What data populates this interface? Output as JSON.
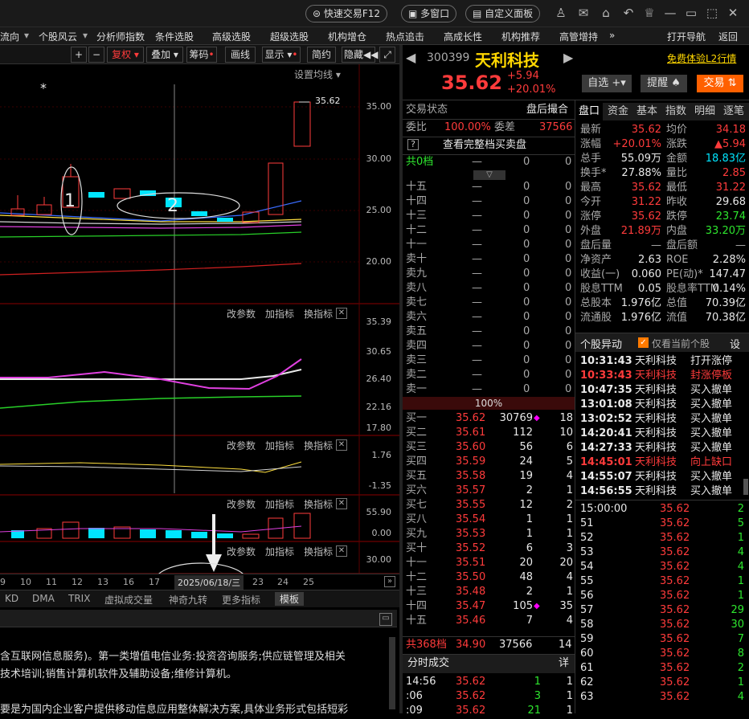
{
  "topbar": {
    "quick_trade": "快速交易F12",
    "multi_window": "多窗口",
    "custom_panel": "自定义面板"
  },
  "nav": {
    "items": [
      "流向",
      "个股风云",
      "分析师指数",
      "条件选股",
      "高级选股",
      "超级选股",
      "机构增仓",
      "热点追击",
      "高成长性",
      "机构推荐",
      "高管增持"
    ],
    "more": "»",
    "open_nav": "打开导航",
    "back": "返回"
  },
  "chart_toolbar": {
    "plus": "+",
    "minus": "−",
    "fq": "复权",
    "overlay": "叠加",
    "chips": "筹码",
    "draw": "画线",
    "display": "显示",
    "simple": "简约",
    "hide": "隐藏"
  },
  "main_chart": {
    "settings": "设置均线",
    "annot_price": "35.62",
    "axis": [
      "35.00",
      "30.00",
      "25.00",
      "20.00"
    ],
    "star": "*",
    "label1": "1",
    "label2": "2"
  },
  "panels": [
    {
      "tools": [
        "改参数",
        "加指标",
        "换指标"
      ],
      "axis": [
        "35.39",
        "30.65",
        "26.40",
        "22.16",
        "17.80"
      ]
    },
    {
      "tools": [
        "改参数",
        "加指标",
        "换指标"
      ],
      "axis": [
        "1.76",
        "-1.35"
      ]
    },
    {
      "tools": [
        "改参数",
        "加指标",
        "换指标"
      ],
      "axis": [
        "55.90",
        "0.00"
      ]
    },
    {
      "tools": [
        "改参数",
        "加指标",
        "换指标"
      ],
      "axis": [
        "30.00"
      ]
    }
  ],
  "x_axis": [
    "9",
    "10",
    "11",
    "12",
    "13",
    "16",
    "17",
    "2025/06/18/三",
    "23",
    "24",
    "25"
  ],
  "ind_tabs": [
    "KD",
    "DMA",
    "TRIX",
    "虚拟成交量",
    "神奇九转",
    "更多指标",
    "模板"
  ],
  "text_area": {
    "lines": [
      "含互联网信息服务)。第一类增值电信业务:投资咨询服务;供应链管理及相关",
      "技术培训;销售计算机软件及辅助设备;维修计算机。",
      "",
      "要是为国内企业客户提供移动信息应用整体解决方案,具体业务形式包括短彩"
    ]
  },
  "stock": {
    "code": "300399",
    "name": "天利科技",
    "price": "35.62",
    "change": "+5.94",
    "pct": "+20.01%",
    "l2": "免费体验L2行情",
    "watch": "自选",
    "alert": "提醒",
    "trade": "交易"
  },
  "order_status": {
    "label": "交易状态",
    "value": "盘后撮合",
    "ratio_label": "委比",
    "ratio": "100.00%",
    "diff_label": "委差",
    "diff": "37566",
    "full_depth": "查看完整档买卖盘",
    "total_sell": "共0档",
    "total_sell_dash": "—",
    "zero": "0"
  },
  "sell_rows": [
    "十五",
    "十四",
    "十三",
    "十二",
    "十一",
    "卖十",
    "卖九",
    "卖八",
    "卖七",
    "卖六",
    "卖五",
    "卖四",
    "卖三",
    "卖二",
    "卖一"
  ],
  "mid_pct": "100%",
  "buy_rows": [
    [
      "买一",
      "35.62",
      "30769",
      "18"
    ],
    [
      "买二",
      "35.61",
      "112",
      "10"
    ],
    [
      "买三",
      "35.60",
      "56",
      "6"
    ],
    [
      "买四",
      "35.59",
      "24",
      "5"
    ],
    [
      "买五",
      "35.58",
      "19",
      "4"
    ],
    [
      "买六",
      "35.57",
      "2",
      "1"
    ],
    [
      "买七",
      "35.55",
      "12",
      "2"
    ],
    [
      "买八",
      "35.54",
      "1",
      "1"
    ],
    [
      "买九",
      "35.53",
      "1",
      "1"
    ],
    [
      "买十",
      "35.52",
      "6",
      "3"
    ],
    [
      "十一",
      "35.51",
      "20",
      "20"
    ],
    [
      "十二",
      "35.50",
      "48",
      "4"
    ],
    [
      "十三",
      "35.48",
      "2",
      "1"
    ],
    [
      "十四",
      "35.47",
      "105",
      "35"
    ],
    [
      "十五",
      "35.46",
      "7",
      "4"
    ]
  ],
  "buy_total": [
    "共368档",
    "34.90",
    "37566",
    "14"
  ],
  "tick_header": "分时成交",
  "tick_detail": "详",
  "ticks": [
    [
      "14:56",
      "35.62",
      "1",
      "1"
    ],
    [
      ":06",
      "35.62",
      "3",
      "1"
    ],
    [
      ":09",
      "35.62",
      "21",
      "1"
    ]
  ],
  "info_tabs": [
    "盘口",
    "资金",
    "基本",
    "指数",
    "明细",
    "逐笔"
  ],
  "quote": [
    [
      "最新",
      "35.62",
      "均价",
      "34.18"
    ],
    [
      "涨幅",
      "+20.01%",
      "涨跌",
      "▲5.94"
    ],
    [
      "总手",
      "55.09万",
      "金额",
      "18.83亿"
    ],
    [
      "换手*",
      "27.88%",
      "量比",
      "2.85"
    ],
    [
      "最高",
      "35.62",
      "最低",
      "31.22"
    ],
    [
      "今开",
      "31.22",
      "昨收",
      "29.68"
    ],
    [
      "涨停",
      "35.62",
      "跌停",
      "23.74"
    ],
    [
      "外盘",
      "21.89万",
      "内盘",
      "33.20万"
    ],
    [
      "盘后量",
      "—",
      "盘后额",
      "—"
    ],
    [
      "净资产",
      "2.63",
      "ROE",
      "2.28%"
    ],
    [
      "收益(一)",
      "0.060",
      "PE(动)*",
      "147.47"
    ],
    [
      "股息TTM",
      "0.05",
      "股息率TTM",
      "0.14%"
    ],
    [
      "总股本",
      "1.976亿",
      "总值",
      "70.39亿"
    ],
    [
      "流通股",
      "1.976亿",
      "流值",
      "70.38亿"
    ]
  ],
  "alerts_header": {
    "title": "个股异动",
    "checkbox": "仅看当前个股",
    "settings": "设"
  },
  "alerts": [
    [
      "10:31:43",
      "天利科技",
      "打开涨停"
    ],
    [
      "10:33:43",
      "天利科技",
      "封涨停板"
    ],
    [
      "10:47:35",
      "天利科技",
      "买入撤单"
    ],
    [
      "13:01:08",
      "天利科技",
      "买入撤单"
    ],
    [
      "13:02:52",
      "天利科技",
      "买入撤单"
    ],
    [
      "14:20:41",
      "天利科技",
      "买入撤单"
    ],
    [
      "14:27:33",
      "天利科技",
      "买入撤单"
    ],
    [
      "14:45:01",
      "天利科技",
      "向上缺口"
    ],
    [
      "14:55:07",
      "天利科技",
      "买入撤单"
    ],
    [
      "14:56:55",
      "天利科技",
      "买入撤单"
    ]
  ],
  "minute_ticks": [
    [
      "15:00:00",
      "35.62",
      "2"
    ],
    [
      "51",
      "35.62",
      "5"
    ],
    [
      "52",
      "35.62",
      "1"
    ],
    [
      "53",
      "35.62",
      "4"
    ],
    [
      "54",
      "35.62",
      "4"
    ],
    [
      "55",
      "35.62",
      "1"
    ],
    [
      "56",
      "35.62",
      "1"
    ],
    [
      "57",
      "35.62",
      "29"
    ],
    [
      "58",
      "35.62",
      "30"
    ],
    [
      "59",
      "35.62",
      "7"
    ],
    [
      "60",
      "35.62",
      "8"
    ],
    [
      "61",
      "35.62",
      "2"
    ],
    [
      "62",
      "35.62",
      "1"
    ],
    [
      "63",
      "35.62",
      "4"
    ]
  ]
}
